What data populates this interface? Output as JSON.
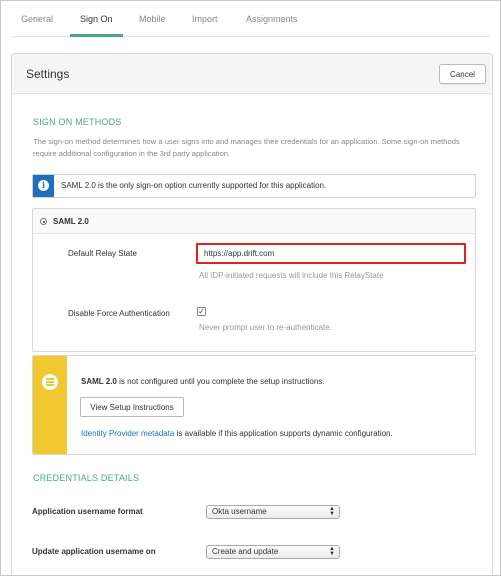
{
  "tabs": [
    {
      "label": "General"
    },
    {
      "label": "Sign On",
      "active": true
    },
    {
      "label": "Mobile"
    },
    {
      "label": "Import"
    },
    {
      "label": "Assignments"
    }
  ],
  "settings": {
    "title": "Settings",
    "cancel_label": "Cancel"
  },
  "sign_on_methods": {
    "heading": "SIGN ON METHODS",
    "description": "The sign-on method determines how a user signs into and manages their credentials for an application. Some sign-on methods require additional configuration in the 3rd party application.",
    "info_text": "SAML 2.0 is the only sign-on option currently supported for this application.",
    "saml": {
      "label": "SAML 2.0",
      "relay_state_label": "Default Relay State",
      "relay_state_value": "https://app.drift.com",
      "relay_state_hint": "All IDP-initiated requests will include this RelayState",
      "force_auth_label": "Disable Force Authentication",
      "force_auth_checked": true,
      "force_auth_hint": "Never prompt user to re-authenticate."
    },
    "warning": {
      "bold": "SAML 2.0",
      "text": " is not configured until you complete the setup instructions.",
      "button_label": "View Setup Instructions",
      "link_label": "Identity Provider metadata",
      "link_suffix": " is available if this application supports dynamic configuration."
    }
  },
  "credentials": {
    "heading": "CREDENTIALS DETAILS",
    "username_format_label": "Application username format",
    "username_format_value": "Okta username",
    "update_on_label": "Update application username on",
    "update_on_value": "Create and update"
  },
  "colors": {
    "accent": "#4aa785",
    "info": "#1f6fbf",
    "warning": "#f0c930",
    "highlight": "#e0241b"
  }
}
